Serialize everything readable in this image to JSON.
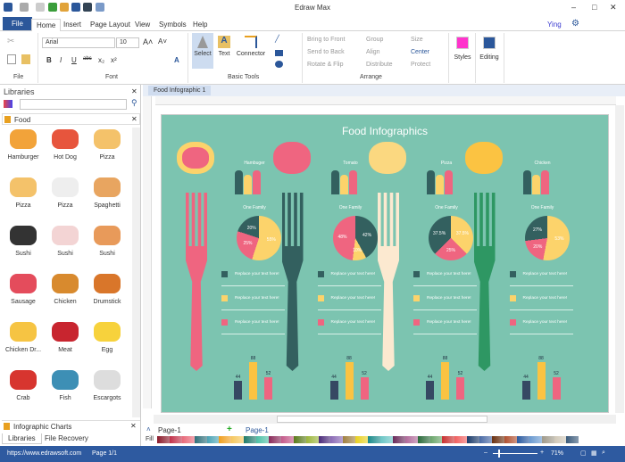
{
  "app": {
    "title": "Edraw Max",
    "user": "Ying"
  },
  "tabs": [
    "File",
    "Home",
    "Insert",
    "Page Layout",
    "View",
    "Symbols",
    "Help"
  ],
  "ribbon": {
    "font_name": "Arial",
    "font_size": "10",
    "groups": {
      "file": "File",
      "font": "Font",
      "basic_tools": "Basic Tools",
      "arrange": "Arrange"
    },
    "tools": {
      "select": "Select",
      "text": "Text",
      "connector": "Connector"
    },
    "arrange": {
      "bring_front": "Bring to Front",
      "send_back": "Send to Back",
      "rotate": "Rotate & Flip",
      "group": "Group",
      "align": "Align",
      "distribute": "Distribute",
      "size": "Size",
      "center": "Center",
      "protect": "Protect"
    },
    "styles": "Styles",
    "editing": "Editing"
  },
  "libraries": {
    "title": "Libraries",
    "search_placeholder": "",
    "section": "Food",
    "items": [
      "Hamburger",
      "Hot Dog",
      "Pizza",
      "Pizza",
      "Pizza",
      "Spaghetti",
      "Sushi",
      "Sushi",
      "Sushi",
      "Sausage",
      "Chicken",
      "Drumstick",
      "Chicken Dr...",
      "Meat",
      "Egg",
      "Crab",
      "Fish",
      "Escargots"
    ],
    "item_colors": [
      "#f2a33a",
      "#e7553d",
      "#f4c26a",
      "#f4c26a",
      "#eee",
      "#e8a560",
      "#333",
      "#f3d4d4",
      "#e89a5a",
      "#e44c5c",
      "#d88a2e",
      "#d9762a",
      "#f6c443",
      "#c8252f",
      "#f7d23c",
      "#d7352f",
      "#3d8fb5",
      "#ddd"
    ],
    "bottom_section": "Infographic Charts",
    "bottom_tabs": [
      "Libraries",
      "File Recovery"
    ]
  },
  "document_tab": "Food Infographic 1",
  "infographic": {
    "title": "Food Infographics",
    "family_label": "One Family",
    "placeholder": "Replace your text here!",
    "columns": [
      {
        "name": "Hambuger",
        "fork": "#ef6580",
        "pie": [
          {
            "v": 55,
            "c": "#fcd36b",
            "l": "55%"
          },
          {
            "v": 25,
            "c": "#ef6580",
            "l": "25%"
          },
          {
            "v": 20,
            "c": "#33605f",
            "l": "20%"
          }
        ]
      },
      {
        "name": "Tomato",
        "fork": "#33605f",
        "pie": [
          {
            "v": 42,
            "c": "#33605f",
            "l": "42%"
          },
          {
            "v": 10,
            "c": "#fcd36b",
            "l": "10%"
          },
          {
            "v": 48,
            "c": "#ef6580",
            "l": "48%"
          }
        ]
      },
      {
        "name": "Pizza",
        "fork": "#fce9d0",
        "pie": [
          {
            "v": 37.5,
            "c": "#fcd36b",
            "l": "37.5%"
          },
          {
            "v": 25,
            "c": "#ef6580",
            "l": "25%"
          },
          {
            "v": 37.5,
            "c": "#33605f",
            "l": "37.5%"
          }
        ]
      },
      {
        "name": "Chicken",
        "fork": "#2e9763",
        "pie": [
          {
            "v": 53,
            "c": "#fcd36b",
            "l": "53%"
          },
          {
            "v": 20,
            "c": "#ef6580",
            "l": "20%"
          },
          {
            "v": 27,
            "c": "#33605f",
            "l": "27%"
          }
        ]
      }
    ],
    "bars": [
      {
        "v": 44,
        "c": "#364863",
        "l": "44"
      },
      {
        "v": 88,
        "c": "#fbc342",
        "l": "88"
      },
      {
        "v": 52,
        "c": "#ef6580",
        "l": "52"
      }
    ],
    "legend_colors": [
      "#33605f",
      "#fcd36b",
      "#ef6580"
    ]
  },
  "pages": {
    "current": "Page-1",
    "tab": "Page-1",
    "fill_label": "Fill"
  },
  "status": {
    "url": "https://www.edrawsoft.com",
    "page": "Page 1/1",
    "zoom": "71%"
  }
}
